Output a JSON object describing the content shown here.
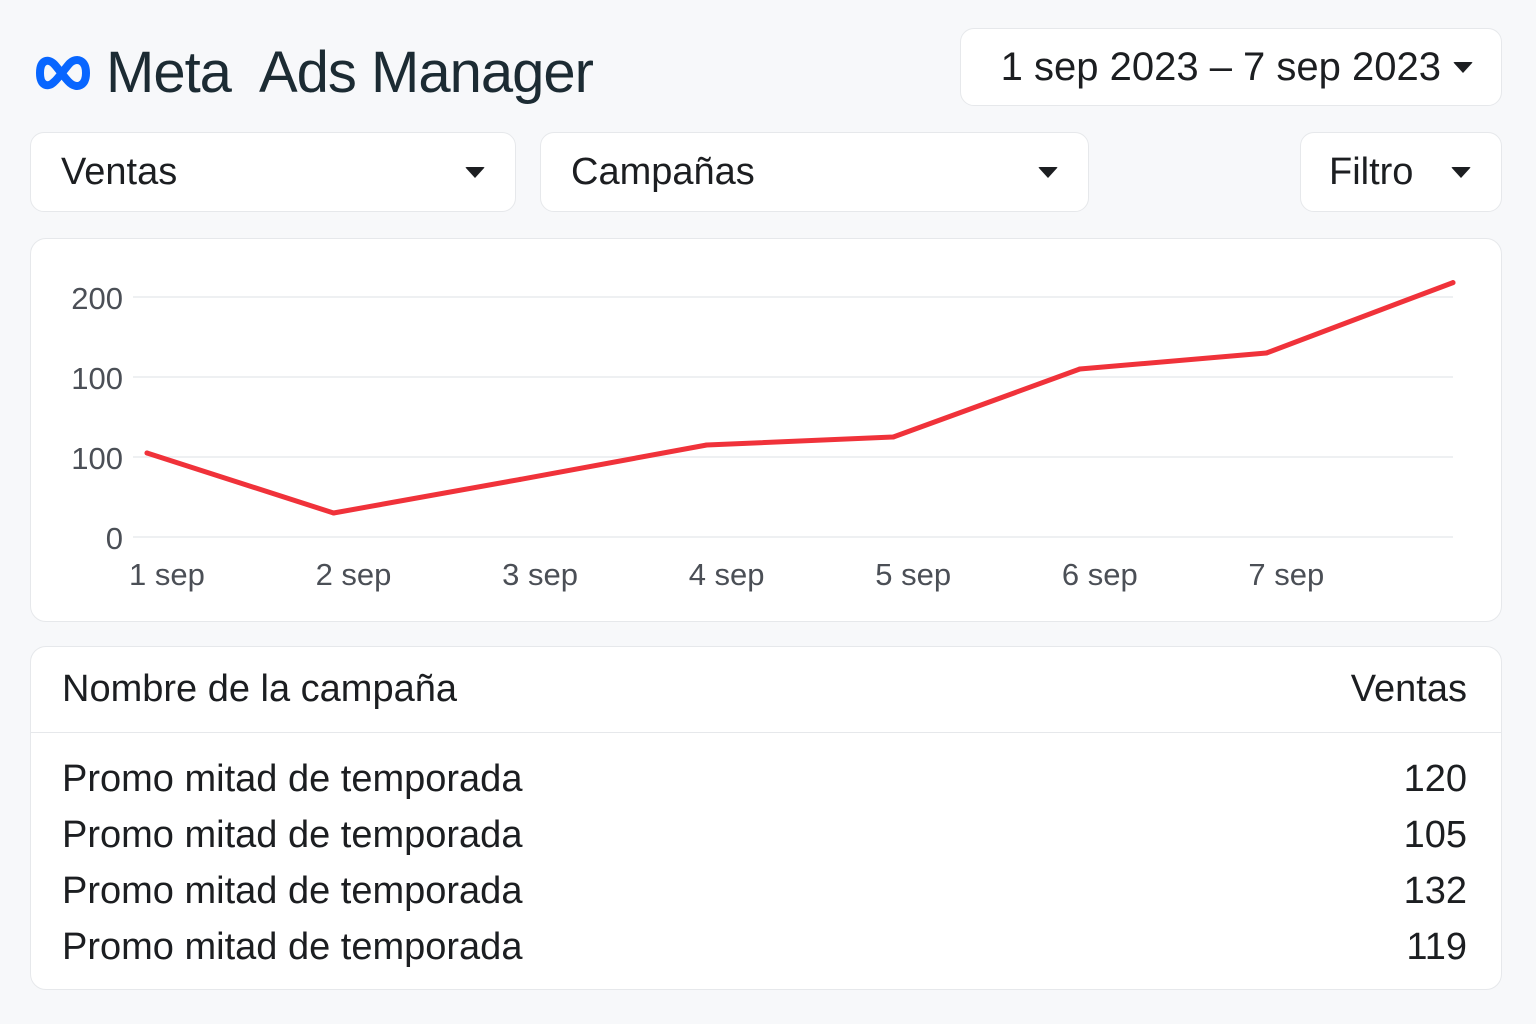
{
  "brand": {
    "company": "Meta",
    "product": "Ads Manager",
    "logo_color": "#0866ff"
  },
  "date_range": {
    "label": "1 sep 2023 – 7 sep 2023",
    "icon": "caret-down-icon"
  },
  "filters": {
    "metric": "Ventas",
    "level": "Campañas",
    "filter": "Filtro"
  },
  "chart_data": {
    "type": "line",
    "x": [
      "1 sep",
      "2 sep",
      "3 sep",
      "4 sep",
      "5 sep",
      "6 sep",
      "7 sep",
      ""
    ],
    "y_tick_labels": [
      "0",
      "100",
      "100",
      "200"
    ],
    "series": [
      {
        "values": [
          105,
          30,
          72,
          115,
          125,
          210,
          230,
          318
        ]
      }
    ],
    "ylim": [
      0,
      300
    ],
    "grid": true,
    "line_color": "#f0323a"
  },
  "table": {
    "columns": [
      "Nombre de la campaña",
      "Ventas"
    ],
    "rows": [
      [
        "Promo mitad de temporada",
        "120"
      ],
      [
        "Promo mitad de temporada",
        "105"
      ],
      [
        "Promo mitad de temporada",
        "132"
      ],
      [
        "Promo mitad de temporada",
        "119"
      ]
    ]
  }
}
